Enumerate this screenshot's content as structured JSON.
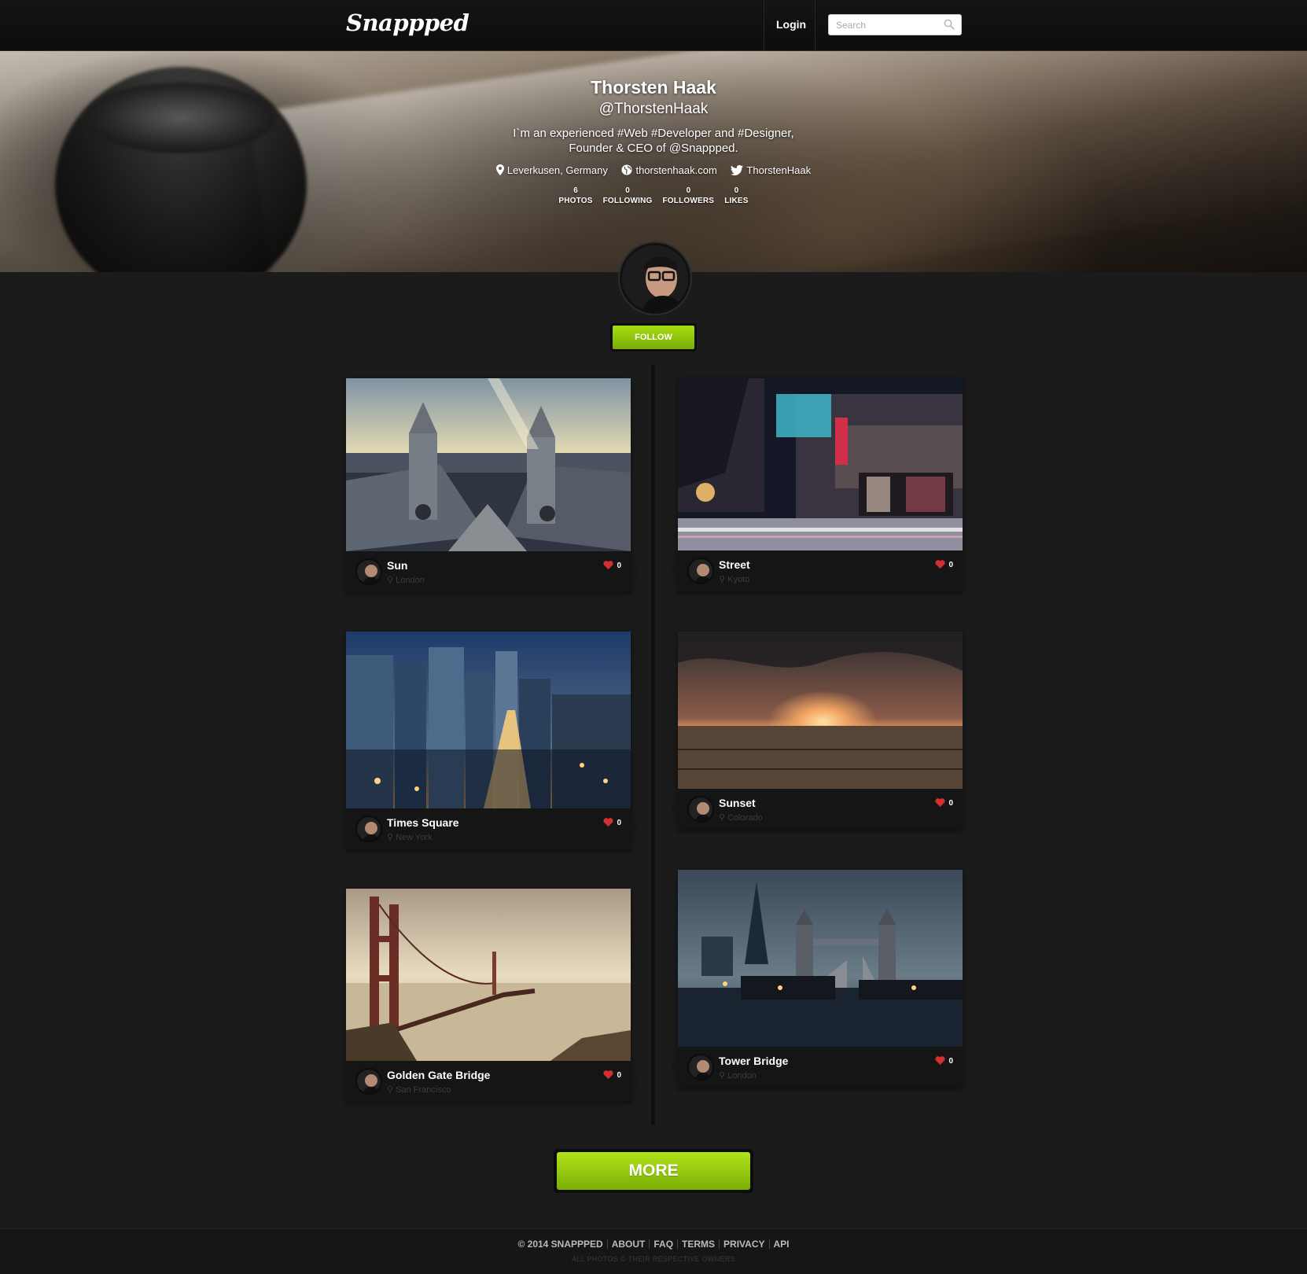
{
  "header": {
    "logo": "Snappped",
    "login_label": "Login",
    "search_placeholder": "Search"
  },
  "profile": {
    "name": "Thorsten Haak",
    "handle": "@ThorstenHaak",
    "bio_line1": "I`m an experienced #Web #Developer and #Designer,",
    "bio_line2": "Founder & CEO of @Snappped.",
    "location": "Leverkusen, Germany",
    "website": "thorstenhaak.com",
    "twitter": "ThorstenHaak",
    "stats": [
      {
        "value": "6",
        "label": "PHOTOS"
      },
      {
        "value": "0",
        "label": "FOLLOWING"
      },
      {
        "value": "0",
        "label": "FOLLOWERS"
      },
      {
        "value": "0",
        "label": "LIKES"
      }
    ],
    "follow_label": "FOLLOW"
  },
  "photos": [
    {
      "title": "Sun",
      "location": "London",
      "likes": "0"
    },
    {
      "title": "Street",
      "location": "Kyoto",
      "likes": "0"
    },
    {
      "title": "Times Square",
      "location": "New York",
      "likes": "0"
    },
    {
      "title": "Sunset",
      "location": "Colorado",
      "likes": "0"
    },
    {
      "title": "Golden Gate Bridge",
      "location": "San Francisco",
      "likes": "0"
    },
    {
      "title": "Tower Bridge",
      "location": "London",
      "likes": "0"
    }
  ],
  "more_label": "MORE",
  "footer": {
    "copyright": "© 2014 SNAPPPED",
    "links": [
      "ABOUT",
      "FAQ",
      "TERMS",
      "PRIVACY",
      "API"
    ],
    "note": "ALL PHOTOS © THEIR RESPECTIVE OWNERS"
  },
  "colors": {
    "accent_green": "#8cc00b",
    "heart_red": "#d23030",
    "background": "#1b1b1b"
  }
}
